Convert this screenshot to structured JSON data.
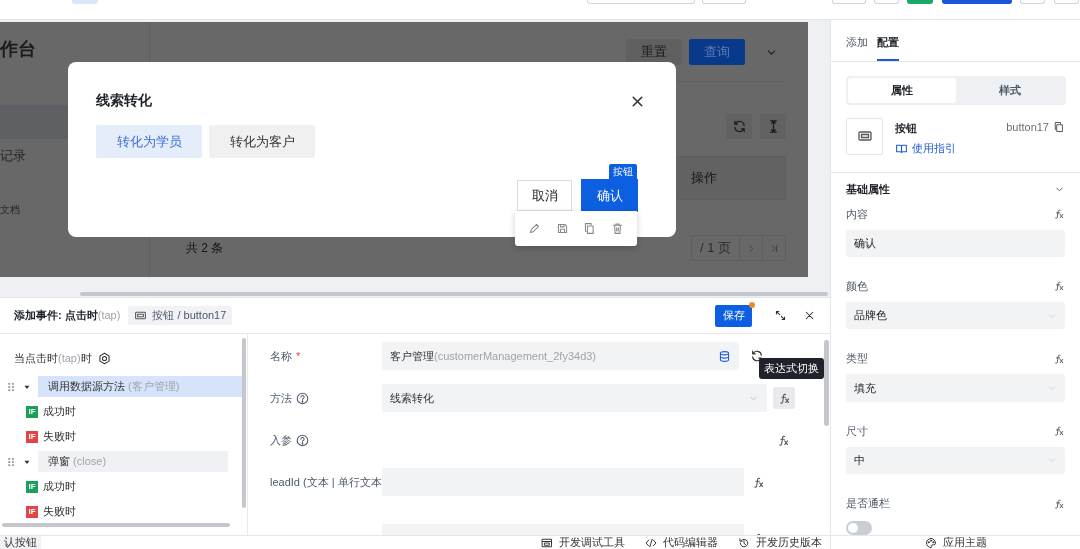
{
  "preview": {
    "heading": "作台",
    "nav": [
      {
        "selected": true
      },
      {
        "label": "记录",
        "selected": false
      },
      {
        "label": "文档",
        "selected": false
      }
    ],
    "buttons": [
      {
        "label": "重置",
        "kind": "secondary"
      },
      {
        "label": "查询",
        "kind": "primary"
      }
    ],
    "column_header": "操作",
    "total": "共 2 条",
    "page": "/ 1 页"
  },
  "modal": {
    "title": "线索转化",
    "tabs": [
      {
        "label": "转化为学员",
        "selected": true
      },
      {
        "label": "转化为客户",
        "selected": false
      }
    ],
    "buttons": [
      {
        "label": "取消",
        "kind": "default",
        "selected": false
      },
      {
        "label": "确认",
        "kind": "primary",
        "selected": true
      }
    ],
    "selection_badge": "按钮"
  },
  "event_panel": {
    "title": "添加事件: 点击时",
    "title_hint": "(tap)",
    "component": "按钮 / button17",
    "save": "保存",
    "unsaved": true,
    "trigger": {
      "label": "当点击时",
      "hint": "(tap)",
      "suffix": "时"
    },
    "actions": [
      {
        "label": "调用数据源方法",
        "hint": "(客户管理)",
        "selected": true,
        "expanded": true,
        "children": [
          {
            "badge": "IF",
            "label": "成功时",
            "kind": "success"
          },
          {
            "badge": "IF",
            "label": "失败时",
            "kind": "fail"
          }
        ]
      },
      {
        "label": "弹窗",
        "hint": "(close)",
        "selected": false,
        "expanded": true,
        "children": [
          {
            "badge": "IF",
            "label": "成功时",
            "kind": "success"
          },
          {
            "badge": "IF",
            "label": "失败时",
            "kind": "fail"
          }
        ]
      }
    ],
    "form": [
      {
        "kind": "source",
        "label": "名称",
        "required_mark": "*",
        "value": "客户管理",
        "hint": "(customerManagement_2fy34d3)"
      },
      {
        "kind": "select",
        "label": "方法",
        "help": true,
        "value": "线索转化"
      },
      {
        "kind": "heading",
        "label": "入参",
        "help": true
      },
      {
        "kind": "param",
        "label": "leadId (文本 | 单行文本"
      },
      {
        "kind": "param"
      }
    ],
    "tooltip": "表达式切换"
  },
  "right_panel": {
    "tabs": [
      {
        "label": "添加",
        "selected": false
      },
      {
        "label": "配置",
        "selected": true
      }
    ],
    "segments": [
      {
        "label": "属性",
        "selected": true
      },
      {
        "label": "样式",
        "selected": false
      }
    ],
    "component": {
      "name": "按钮",
      "guide": "使用指引",
      "id": "button17"
    },
    "section": {
      "title": "基础属性",
      "expanded": true
    },
    "props": [
      {
        "label": "内容",
        "kind": "input",
        "value": "确认"
      },
      {
        "label": "颜色",
        "kind": "select",
        "value": "品牌色"
      },
      {
        "label": "类型",
        "kind": "select",
        "value": "填充"
      },
      {
        "label": "尺寸",
        "kind": "select",
        "value": "中"
      },
      {
        "label": "是否通栏",
        "kind": "switch",
        "on": false
      }
    ]
  },
  "footer": {
    "left_tab": "认按钮",
    "tools": [
      {
        "label": "开发调试工具",
        "kind": "debug"
      },
      {
        "label": "代码编辑器",
        "kind": "code"
      },
      {
        "label": "开发历史版本",
        "kind": "history"
      }
    ],
    "theme": "应用主题"
  }
}
